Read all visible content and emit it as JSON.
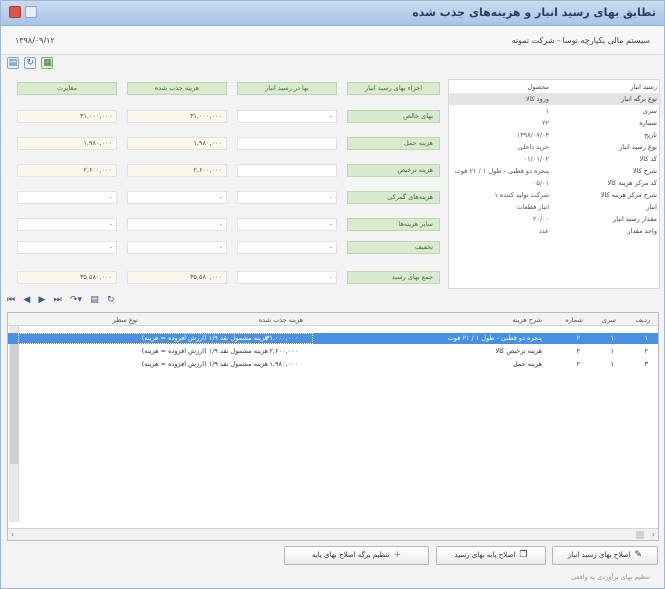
{
  "window": {
    "title": "تطابق بهای رسید انبار و هزینه‌های جذب شده",
    "date": "۱۳۹۸/۰۹/۱۲",
    "company": "سیستم مالی یکپارچه نوسا - شرکت نمونه"
  },
  "info": {
    "rows": [
      {
        "k": "رسید انبار",
        "v": "محصول"
      },
      {
        "k": "نوع برگه انبار",
        "v": "ورود کالا"
      },
      {
        "k": "سری",
        "v": "۱"
      },
      {
        "k": "شماره",
        "v": "۲۲"
      },
      {
        "k": "تاریخ",
        "v": "۱۳۹۸/۰۷/۰۴"
      },
      {
        "k": "نوع رسید انبار",
        "v": "خرید داخلی"
      },
      {
        "k": "کد کالا",
        "v": "۰۱/۰۱/۰۲"
      },
      {
        "k": "شرح کالا",
        "v": "پنجره دو قطبی - طول ۱ / ۲۱ فوت"
      },
      {
        "k": "کد مرکز هزینه کالا",
        "v": "۰۵/۰۱"
      },
      {
        "k": "شرح مرکز هزینه کالا",
        "v": "شرکت تولید کننده ۱"
      },
      {
        "k": "انبار",
        "v": "انبار قطعات"
      },
      {
        "k": "مقدار رسید انبار",
        "v": "۲۰/۰۰"
      },
      {
        "k": "واحد مقدار",
        "v": "عدد"
      }
    ]
  },
  "cost": {
    "headers": {
      "item": "اجزاء بهای رسید انبار",
      "price": "بها در رسید انبار",
      "absorbed": "هزینه جذب شده",
      "diff": "مغایرت"
    },
    "rows": [
      {
        "label": "بهای خالص",
        "price": "-",
        "absorbed": "۳۱,۰۰۰,۰۰۰",
        "diff": "۳۱,۰۰۰,۰۰۰"
      },
      {
        "label": "هزینه حمل",
        "price": "",
        "absorbed": "۱,۹۸۰,۰۰۰",
        "diff": "۱,۹۸۰,۰۰۰"
      },
      {
        "label": "هزینه ترخیص",
        "price": "",
        "absorbed": "۲,۶۰۰,۰۰۰",
        "diff": "۲,۶۰۰,۰۰۰"
      },
      {
        "label": "هزینه‌های گمرکی",
        "price": "-",
        "absorbed": "-",
        "diff": "-"
      },
      {
        "label": "سایر هزینه‌ها",
        "price": "-",
        "absorbed": "-",
        "diff": "-"
      },
      {
        "label": "تخفیف",
        "price": "-",
        "absorbed": "-",
        "diff": "-"
      },
      {
        "label": "جمع بهای رسید",
        "price": "-",
        "absorbed": "۳۵,۵۸۰,۰۰۰",
        "diff": "۳۵,۵۸۰,۰۰۰"
      }
    ]
  },
  "grid": {
    "headers": {
      "radif": "ردیف",
      "seri": "سری",
      "shomare": "شماره",
      "sharh": "شرح هزینه",
      "jazb": "هزینه جذب شده",
      "sanad": "نوع سطر"
    },
    "rows": [
      {
        "radif": "۱",
        "seri": "۱",
        "shomare": "۲",
        "sharh": "پنجره دو قطبی - طول ۱ / ۲۱ فوت",
        "jazb": "۳۱,۰۰۰,۰۰۰",
        "sanad": "هزینه مشمول نقد ۱/۹ (ارزش افزوده = هزینه)"
      },
      {
        "radif": "۲",
        "seri": "۱",
        "shomare": "۲",
        "sharh": "هزینه ترخیص کالا",
        "jazb": "۲,۶۰۰,۰۰۰",
        "sanad": "هزینه مشمول نقد ۱/۹ (ارزش افزوده = هزینه)"
      },
      {
        "radif": "۳",
        "seri": "۱",
        "shomare": "۲",
        "sharh": "هزینه حمل",
        "jazb": "۱,۹۸۰,۰۰۰",
        "sanad": "هزینه مشمول نقد ۱/۹ (ارزش افزوده = هزینه)"
      }
    ]
  },
  "buttons": {
    "fix_price": "اصلاح بهای رسید انبار",
    "fix_base": "اصلاح پایه بهای رسید",
    "new_sheet": "تنظیم برگه اصلاح بهای پایه"
  },
  "footnote": "تنظیم بهای برآوردی به واقعی"
}
